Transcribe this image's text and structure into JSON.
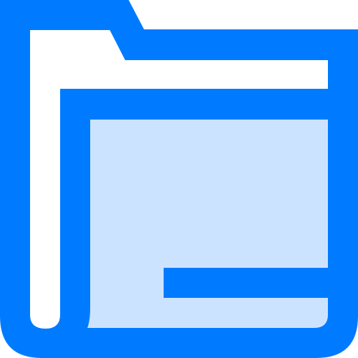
{
  "icon": {
    "name": "folder-icon",
    "colors": {
      "stroke": "#007bff",
      "fill": "#cce3ff",
      "background": "#ffffff"
    }
  }
}
